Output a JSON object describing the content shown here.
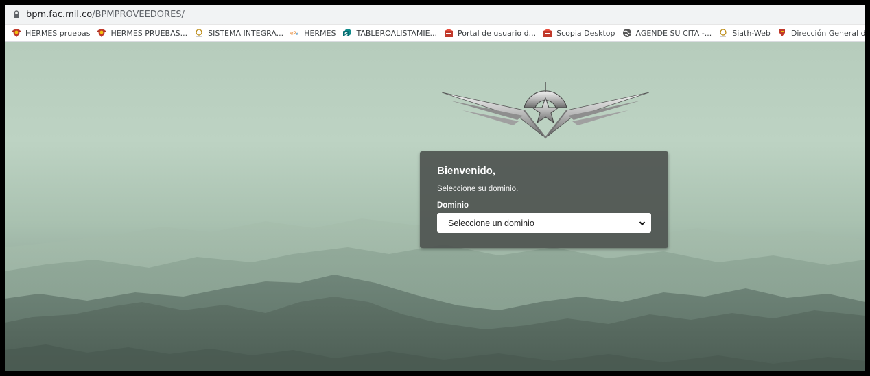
{
  "browser": {
    "url_host": "bpm.fac.mil.co",
    "url_path": "/BPMPROVEEDORES/",
    "bookmarks": [
      {
        "label": "HERMES pruebas",
        "icon": "shield-crest-icon"
      },
      {
        "label": "HERMES PRUEBAS...",
        "icon": "shield-crest-icon"
      },
      {
        "label": "SISTEMA INTEGRA...",
        "icon": "globe-emblem-icon"
      },
      {
        "label": "HERMES",
        "icon": "eps-logo-icon"
      },
      {
        "label": "TABLEROALISTAMIE...",
        "icon": "sharepoint-icon"
      },
      {
        "label": "Portal de usuario d...",
        "icon": "red-portal-icon"
      },
      {
        "label": "Scopia Desktop",
        "icon": "red-portal-icon"
      },
      {
        "label": "AGENDE SU CITA -...",
        "icon": "globe-icon"
      },
      {
        "label": "Siath-Web",
        "icon": "globe-emblem-icon"
      },
      {
        "label": "Dirección General d...",
        "icon": "shield-red-icon"
      }
    ],
    "more_icon": "chevron-left-icon"
  },
  "login": {
    "title": "Bienvenido,",
    "subtitle": "Seleccione su dominio.",
    "domain_label": "Dominio",
    "domain_select_value": "Seleccione un dominio"
  },
  "colors": {
    "panel_bg": "#4e5450",
    "sky_top": "#b6ccbc",
    "mountain_dark": "#5f7267"
  }
}
